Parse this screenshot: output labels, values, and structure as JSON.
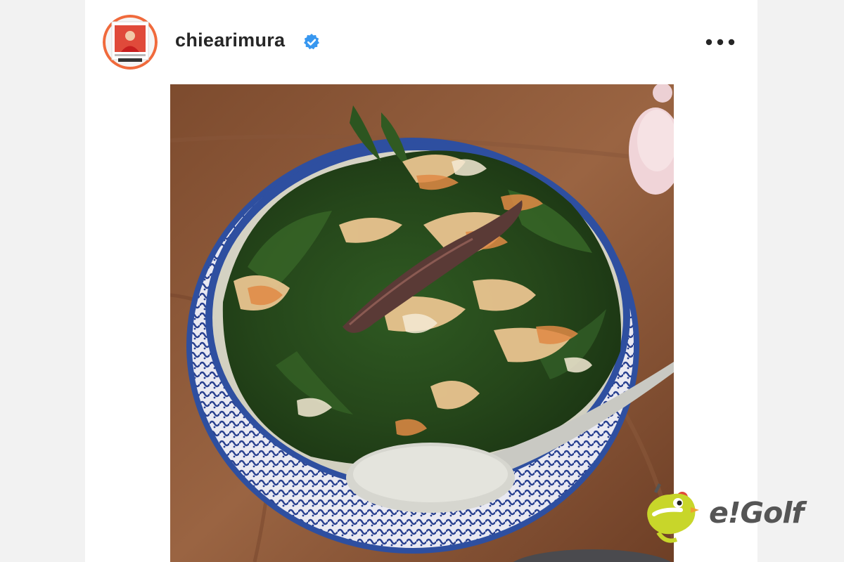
{
  "post": {
    "username": "chiearimura",
    "verified": true,
    "verified_icon": "verified-badge-icon",
    "more_icon": "more-options-icon"
  },
  "photo": {
    "subject_icon": "food-photo"
  },
  "watermark": {
    "text": "e!Golf",
    "logo_icon": "egolf-mascot-logo"
  },
  "colors": {
    "verified_blue": "#3797f0",
    "avatar_ring": "#f06a3c",
    "bowl_blue": "#2e4fa0",
    "watermark_green": "#c8d62a",
    "watermark_gray": "#555555"
  }
}
